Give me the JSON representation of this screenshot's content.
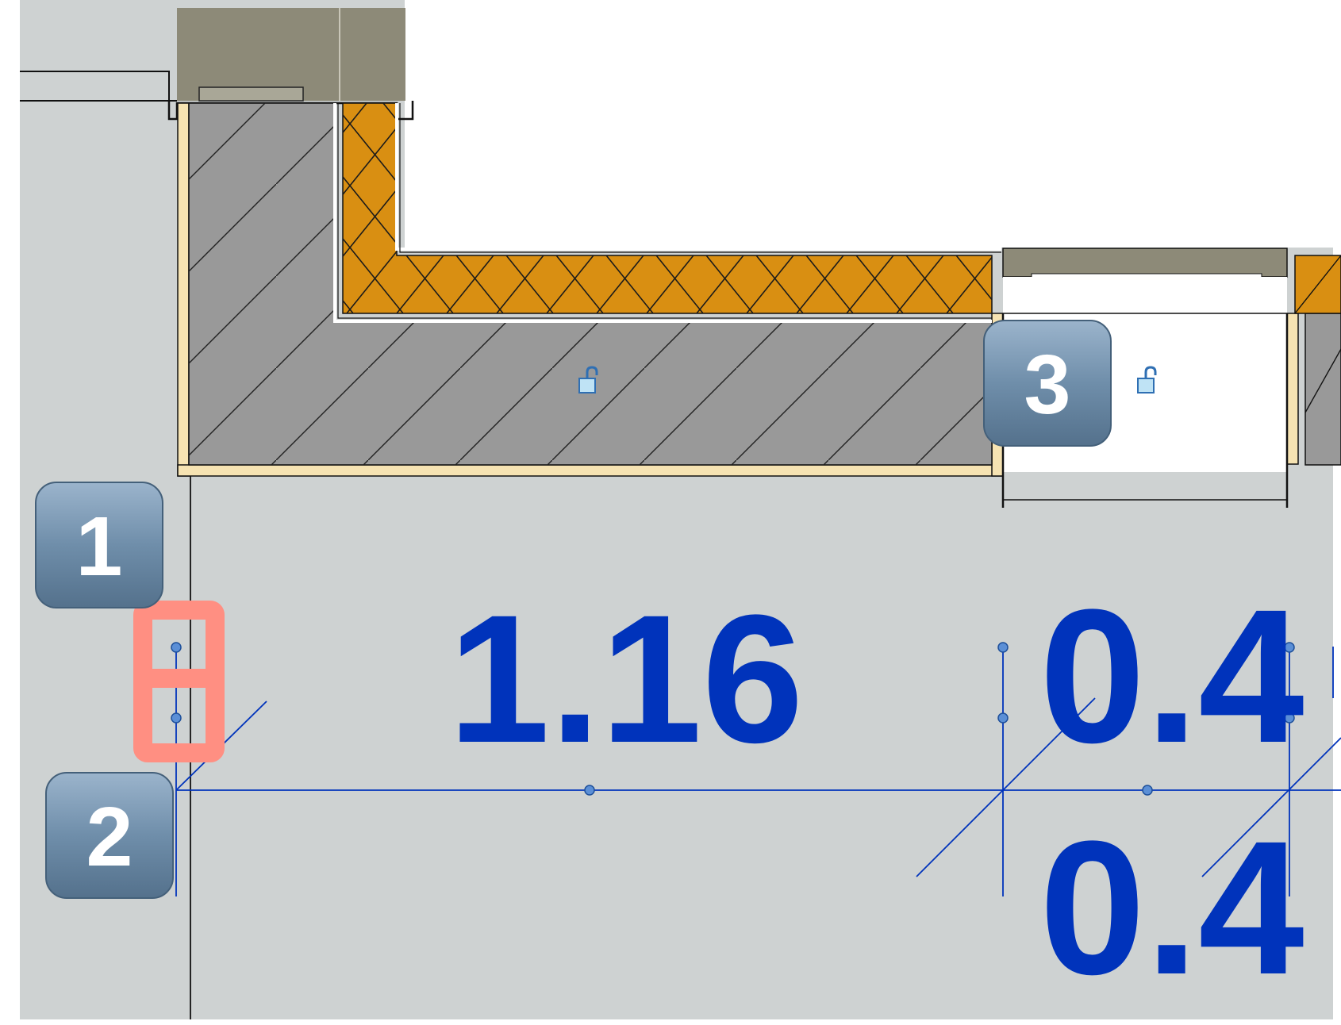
{
  "colors": {
    "canvas_bg": "#ced2d2",
    "concrete": "#999999",
    "insulation": "#d98f12",
    "finish_cream": "#f6e3b2",
    "wall_cap": "#8d8a78",
    "dimension_blue": "#0033bb",
    "grip_blue": "#5b8fd6",
    "badge_fill": "#6f8eaa",
    "highlight_salmon": "#ff8f82"
  },
  "dimensions": {
    "upper_left": "1.16",
    "upper_right": "0.4",
    "lower_right": "0.4"
  },
  "badges": [
    {
      "label": "1"
    },
    {
      "label": "2"
    },
    {
      "label": "3"
    }
  ],
  "icons": {
    "lock_left": "unlock-icon",
    "lock_right": "unlock-icon"
  }
}
